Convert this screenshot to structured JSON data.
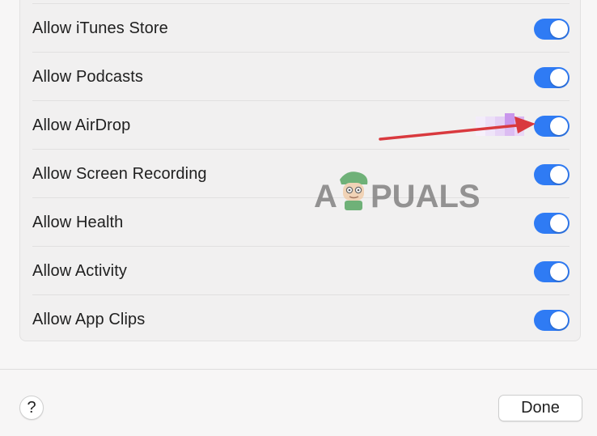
{
  "settings": {
    "items": [
      {
        "label": "Allow iTunes Store",
        "enabled": true
      },
      {
        "label": "Allow Podcasts",
        "enabled": true
      },
      {
        "label": "Allow AirDrop",
        "enabled": true
      },
      {
        "label": "Allow Screen Recording",
        "enabled": true
      },
      {
        "label": "Allow Health",
        "enabled": true
      },
      {
        "label": "Allow Activity",
        "enabled": true
      },
      {
        "label": "Allow App Clips",
        "enabled": true
      }
    ]
  },
  "footer": {
    "help_label": "?",
    "done_label": "Done"
  },
  "watermark": {
    "text": "APPUALS"
  },
  "colors": {
    "toggle_on": "#2f7bf4",
    "arrow": "#d9393e"
  }
}
